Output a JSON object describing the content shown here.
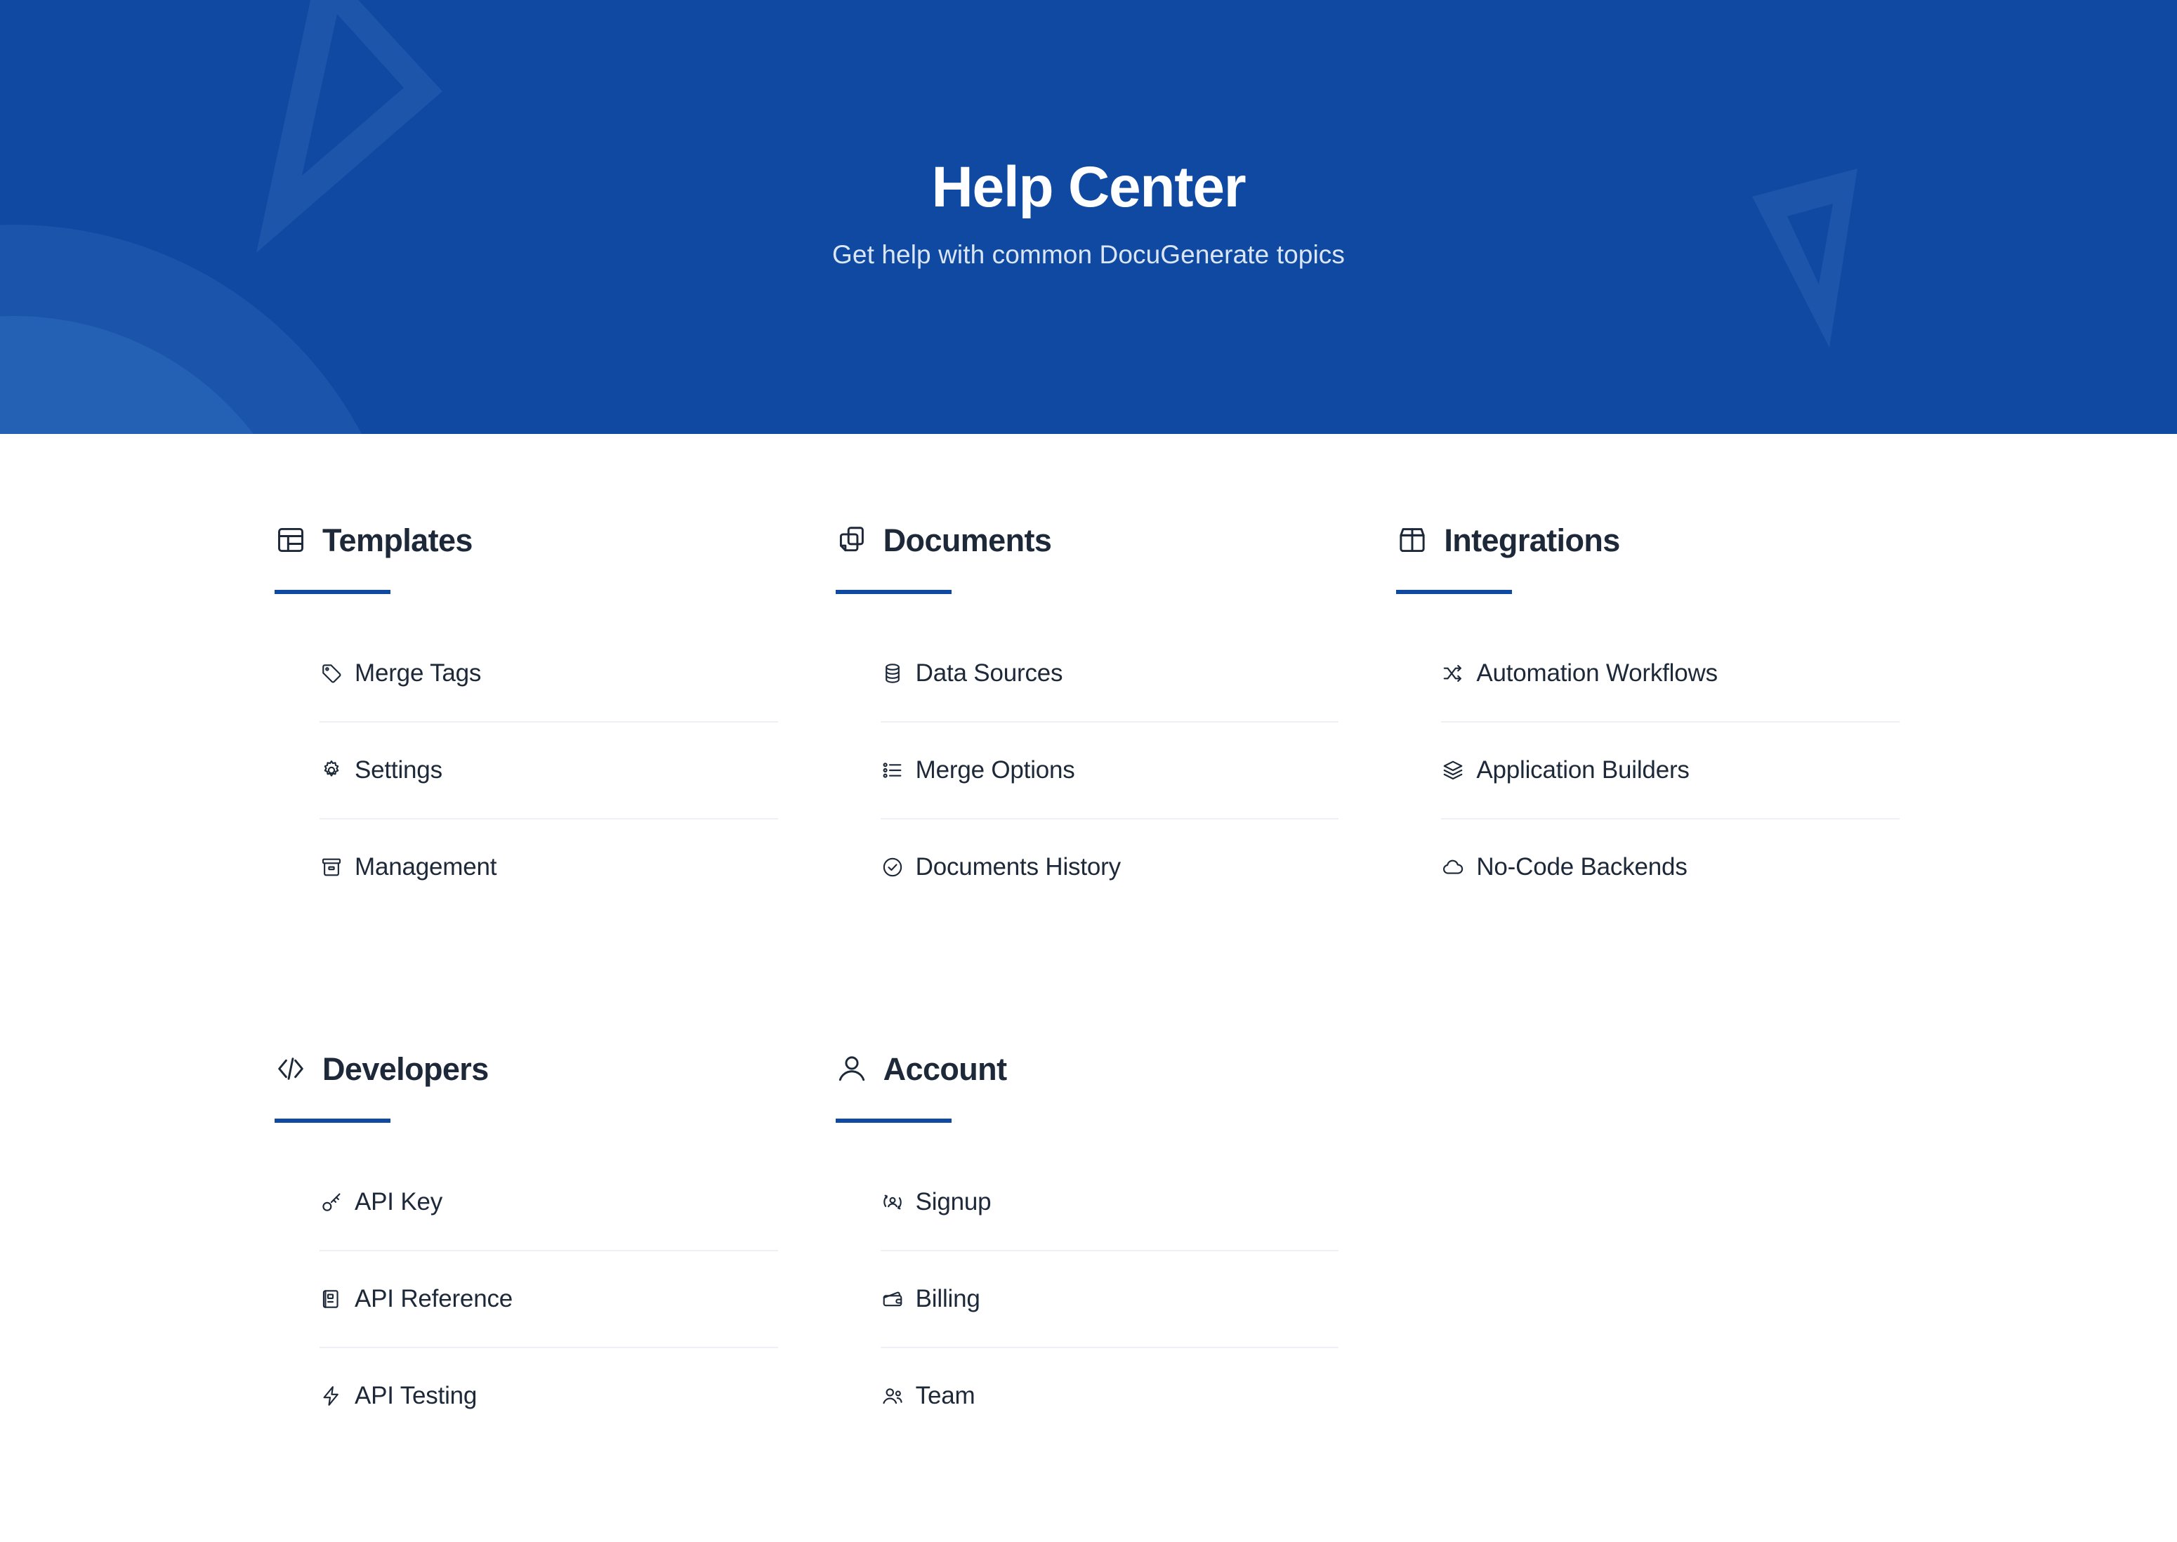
{
  "hero": {
    "title": "Help Center",
    "subtitle": "Get help with common DocuGenerate topics",
    "background_color": "#0F49A1",
    "title_color": "#ffffff",
    "subtitle_color": "#dbe6f5",
    "decor": [
      "triangle-outline-left",
      "triangle-outline-right",
      "concentric-arcs-bottom-left"
    ]
  },
  "theme": {
    "accent_color": "#0F49A1",
    "text_color": "#1d2939",
    "divider_color": "#eef0f5",
    "page_background": "#ffffff"
  },
  "categories": [
    {
      "id": "templates",
      "title": "Templates",
      "icon": "layout-panel-icon",
      "items": [
        {
          "label": "Merge Tags",
          "icon": "tag-icon"
        },
        {
          "label": "Settings",
          "icon": "gear-icon"
        },
        {
          "label": "Management",
          "icon": "archive-box-icon"
        }
      ]
    },
    {
      "id": "documents",
      "title": "Documents",
      "icon": "documents-stack-icon",
      "items": [
        {
          "label": "Data Sources",
          "icon": "database-icon"
        },
        {
          "label": "Merge Options",
          "icon": "bullet-list-icon"
        },
        {
          "label": "Documents History",
          "icon": "check-circle-icon"
        }
      ]
    },
    {
      "id": "integrations",
      "title": "Integrations",
      "icon": "package-box-icon",
      "items": [
        {
          "label": "Automation Workflows",
          "icon": "shuffle-icon"
        },
        {
          "label": "Application Builders",
          "icon": "layers-stack-icon"
        },
        {
          "label": "No-Code Backends",
          "icon": "cloud-icon"
        }
      ]
    },
    {
      "id": "developers",
      "title": "Developers",
      "icon": "code-brackets-icon",
      "items": [
        {
          "label": "API Key",
          "icon": "key-icon"
        },
        {
          "label": "API Reference",
          "icon": "book-icon"
        },
        {
          "label": "API Testing",
          "icon": "lightning-bolt-icon"
        }
      ]
    },
    {
      "id": "account",
      "title": "Account",
      "icon": "user-icon",
      "items": [
        {
          "label": "Signup",
          "icon": "user-switch-icon"
        },
        {
          "label": "Billing",
          "icon": "wallet-icon"
        },
        {
          "label": "Team",
          "icon": "users-icon"
        }
      ]
    }
  ]
}
